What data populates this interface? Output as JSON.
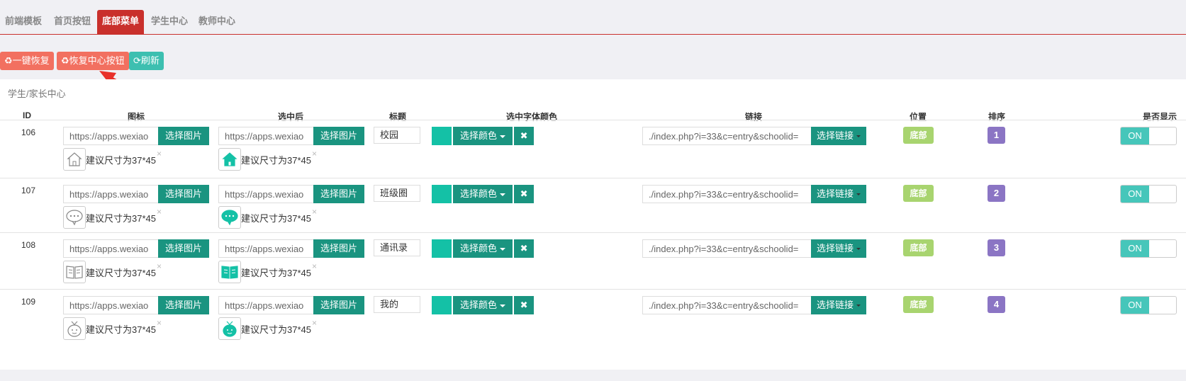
{
  "tabs": [
    {
      "label": "前端模板",
      "active": false
    },
    {
      "label": "首页按钮",
      "active": false
    },
    {
      "label": "底部菜单",
      "active": true
    },
    {
      "label": "学生中心",
      "active": false
    },
    {
      "label": "教师中心",
      "active": false
    }
  ],
  "toolbar": {
    "restore_all": "一键恢复",
    "restore_center": "恢复中心按钮",
    "refresh": "刷新"
  },
  "section_title": "学生/家长中心",
  "columns": [
    "ID",
    "图标",
    "选中后",
    "标题",
    "选中字体颜色",
    "链接",
    "位置",
    "排序",
    "是否显示"
  ],
  "common": {
    "select_image": "选择图片",
    "size_hint": "建议尺寸为37*45",
    "remove": "×",
    "select_color": "选择颜色",
    "clear_color": "✖",
    "select_link": "选择链接",
    "toggle_on": "ON",
    "accent_color": "#14c1a6"
  },
  "rows": [
    {
      "id": "106",
      "icon_url": "https://apps.wexiao",
      "selected_url": "https://apps.wexiao",
      "title": "校园",
      "link": "./index.php?i=33&c=entry&schoolid=",
      "position": "底部",
      "order": "1",
      "visible": true,
      "icon": "home-icon"
    },
    {
      "id": "107",
      "icon_url": "https://apps.wexiao",
      "selected_url": "https://apps.wexiao",
      "title": "班级圈",
      "link": "./index.php?i=33&c=entry&schoolid=",
      "position": "底部",
      "order": "2",
      "visible": true,
      "icon": "chat-icon"
    },
    {
      "id": "108",
      "icon_url": "https://apps.wexiao",
      "selected_url": "https://apps.wexiao",
      "title": "通讯录",
      "link": "./index.php?i=33&c=entry&schoolid=",
      "position": "底部",
      "order": "3",
      "visible": true,
      "icon": "book-icon"
    },
    {
      "id": "109",
      "icon_url": "https://apps.wexiao",
      "selected_url": "https://apps.wexiao",
      "title": "我的",
      "link": "./index.php?i=33&c=entry&schoolid=",
      "position": "底部",
      "order": "4",
      "visible": true,
      "icon": "user-icon"
    }
  ]
}
